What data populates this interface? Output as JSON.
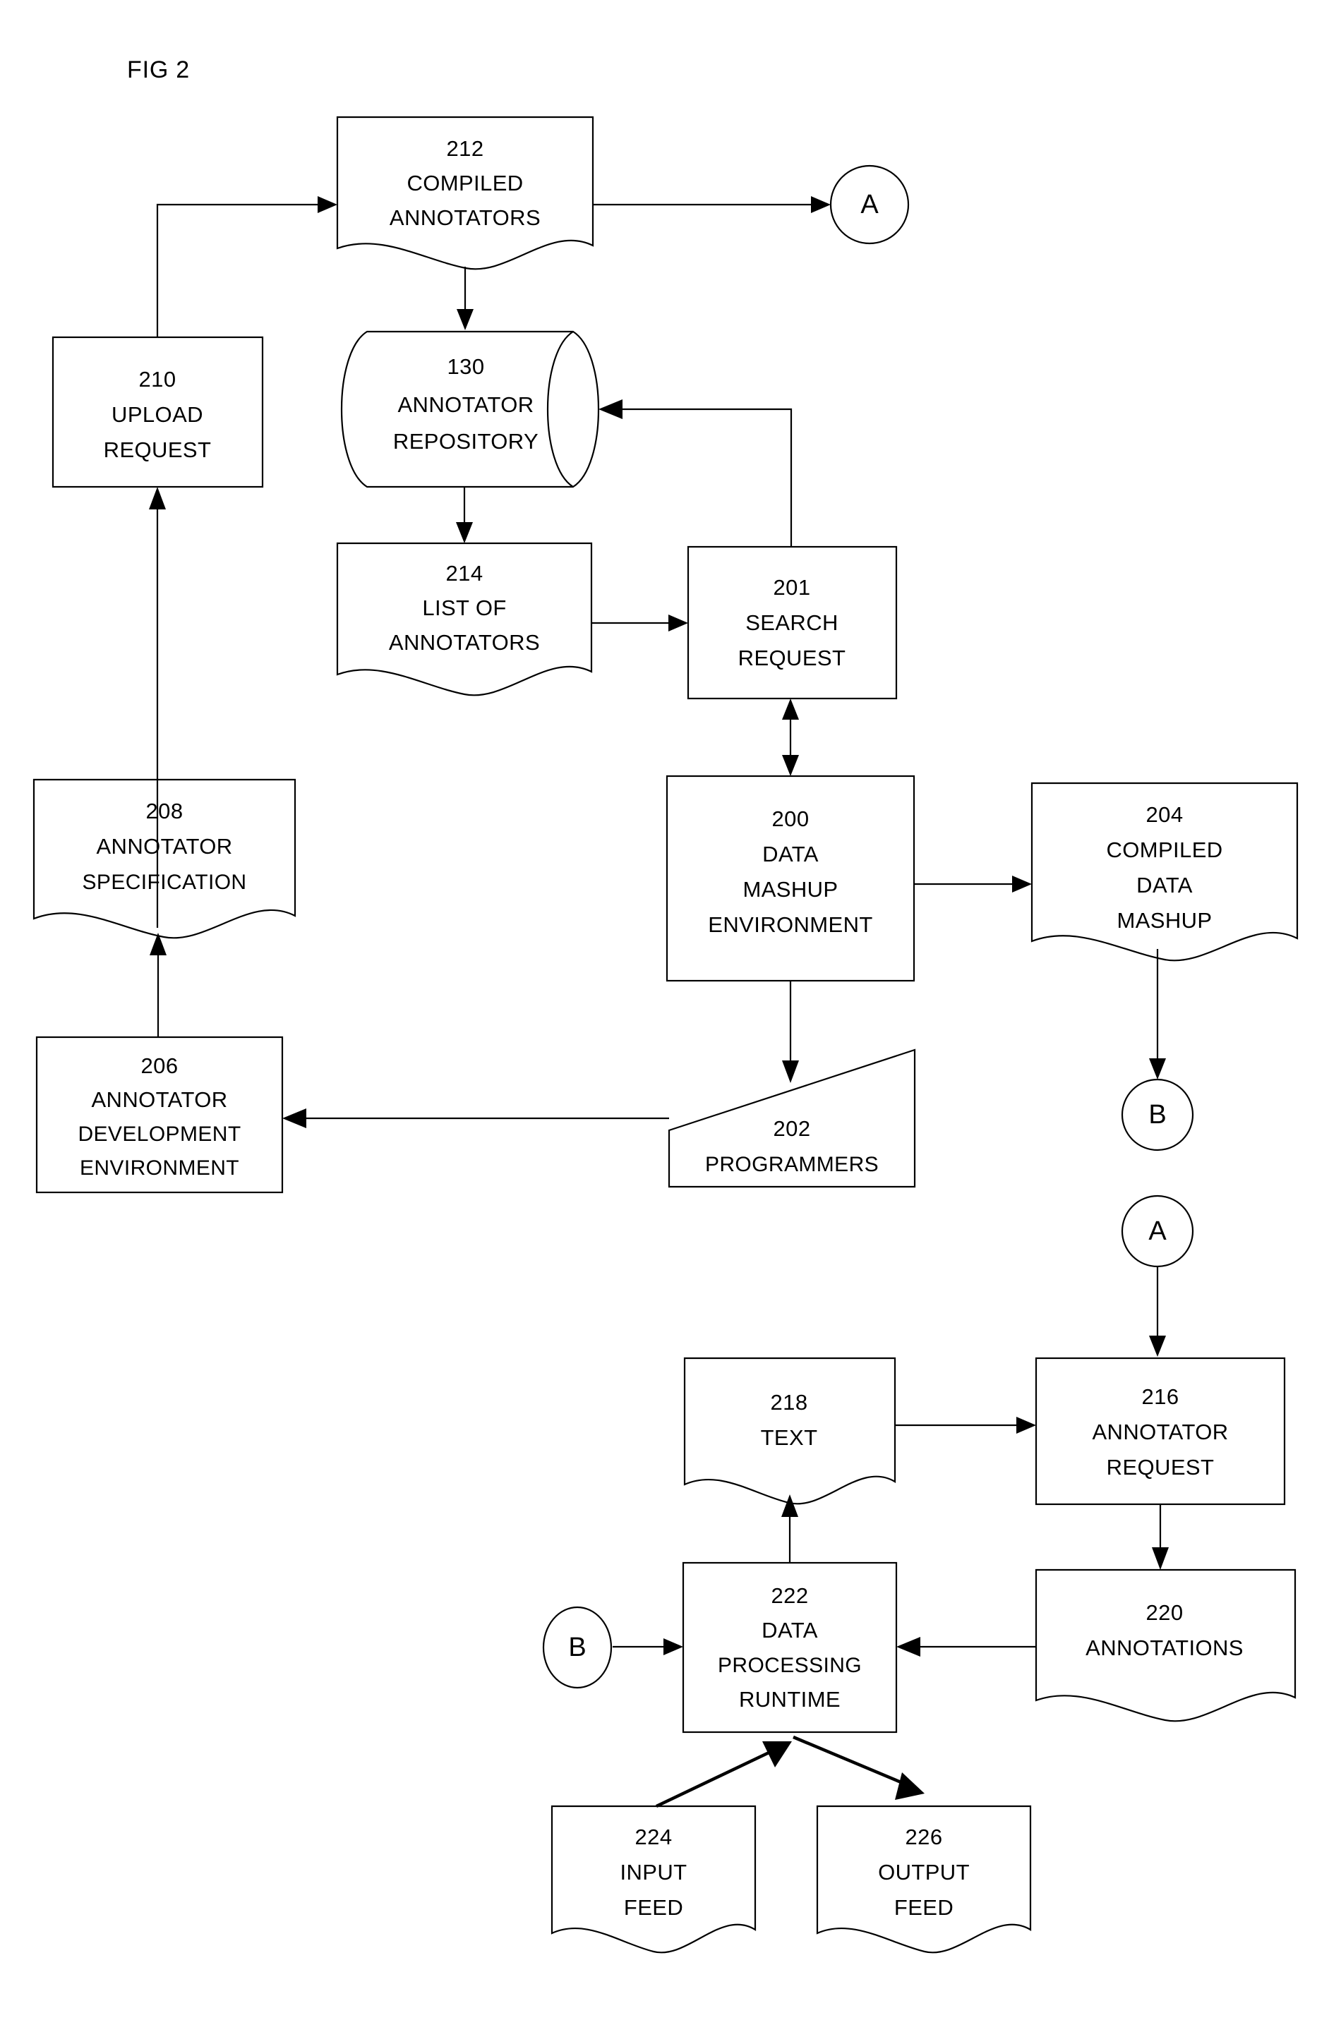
{
  "figure": {
    "title": "FIG 2",
    "type": "patent-flowchart"
  },
  "nodes": {
    "n212": {
      "ref": "212",
      "line1": "COMPILED",
      "line2": "ANNOTATORS",
      "shape": "document"
    },
    "n130": {
      "ref": "130",
      "line1": "ANNOTATOR",
      "line2": "REPOSITORY",
      "shape": "cylinder"
    },
    "n210": {
      "ref": "210",
      "line1": "UPLOAD",
      "line2": "REQUEST",
      "shape": "rectangle"
    },
    "n214": {
      "ref": "214",
      "line1": "LIST OF",
      "line2": "ANNOTATORS",
      "shape": "document"
    },
    "n201": {
      "ref": "201",
      "line1": "SEARCH",
      "line2": "REQUEST",
      "shape": "rectangle"
    },
    "n200": {
      "ref": "200",
      "line1": "DATA",
      "line2": "MASHUP",
      "line3": "ENVIRONMENT",
      "shape": "rectangle"
    },
    "n204": {
      "ref": "204",
      "line1": "COMPILED",
      "line2": "DATA",
      "line3": "MASHUP",
      "shape": "document"
    },
    "n208": {
      "ref": "208",
      "line1": "ANNOTATOR",
      "line2": "SPECIFICATION",
      "shape": "document"
    },
    "n206": {
      "ref": "206",
      "line1": "ANNOTATOR",
      "line2": "DEVELOPMENT",
      "line3": "ENVIRONMENT",
      "shape": "rectangle"
    },
    "n202": {
      "ref": "202",
      "line1": "PROGRAMMERS",
      "shape": "manual-input"
    },
    "n218": {
      "ref": "218",
      "line1": "TEXT",
      "shape": "document"
    },
    "n216": {
      "ref": "216",
      "line1": "ANNOTATOR",
      "line2": "REQUEST",
      "shape": "rectangle"
    },
    "n220": {
      "ref": "220",
      "line1": "ANNOTATIONS",
      "shape": "document"
    },
    "n222": {
      "ref": "222",
      "line1": "DATA",
      "line2": "PROCESSING",
      "line3": "RUNTIME",
      "shape": "rectangle"
    },
    "n224": {
      "ref": "224",
      "line1": "INPUT",
      "line2": "FEED",
      "shape": "document"
    },
    "n226": {
      "ref": "226",
      "line1": "OUTPUT",
      "line2": "FEED",
      "shape": "document"
    }
  },
  "connectors": {
    "a_top": {
      "label": "A"
    },
    "b_mid": {
      "label": "B"
    },
    "a_mid": {
      "label": "A"
    },
    "b_bottom": {
      "label": "B"
    }
  },
  "colors": {
    "line": "#000000",
    "fill": "#ffffff",
    "text": "#000000"
  }
}
